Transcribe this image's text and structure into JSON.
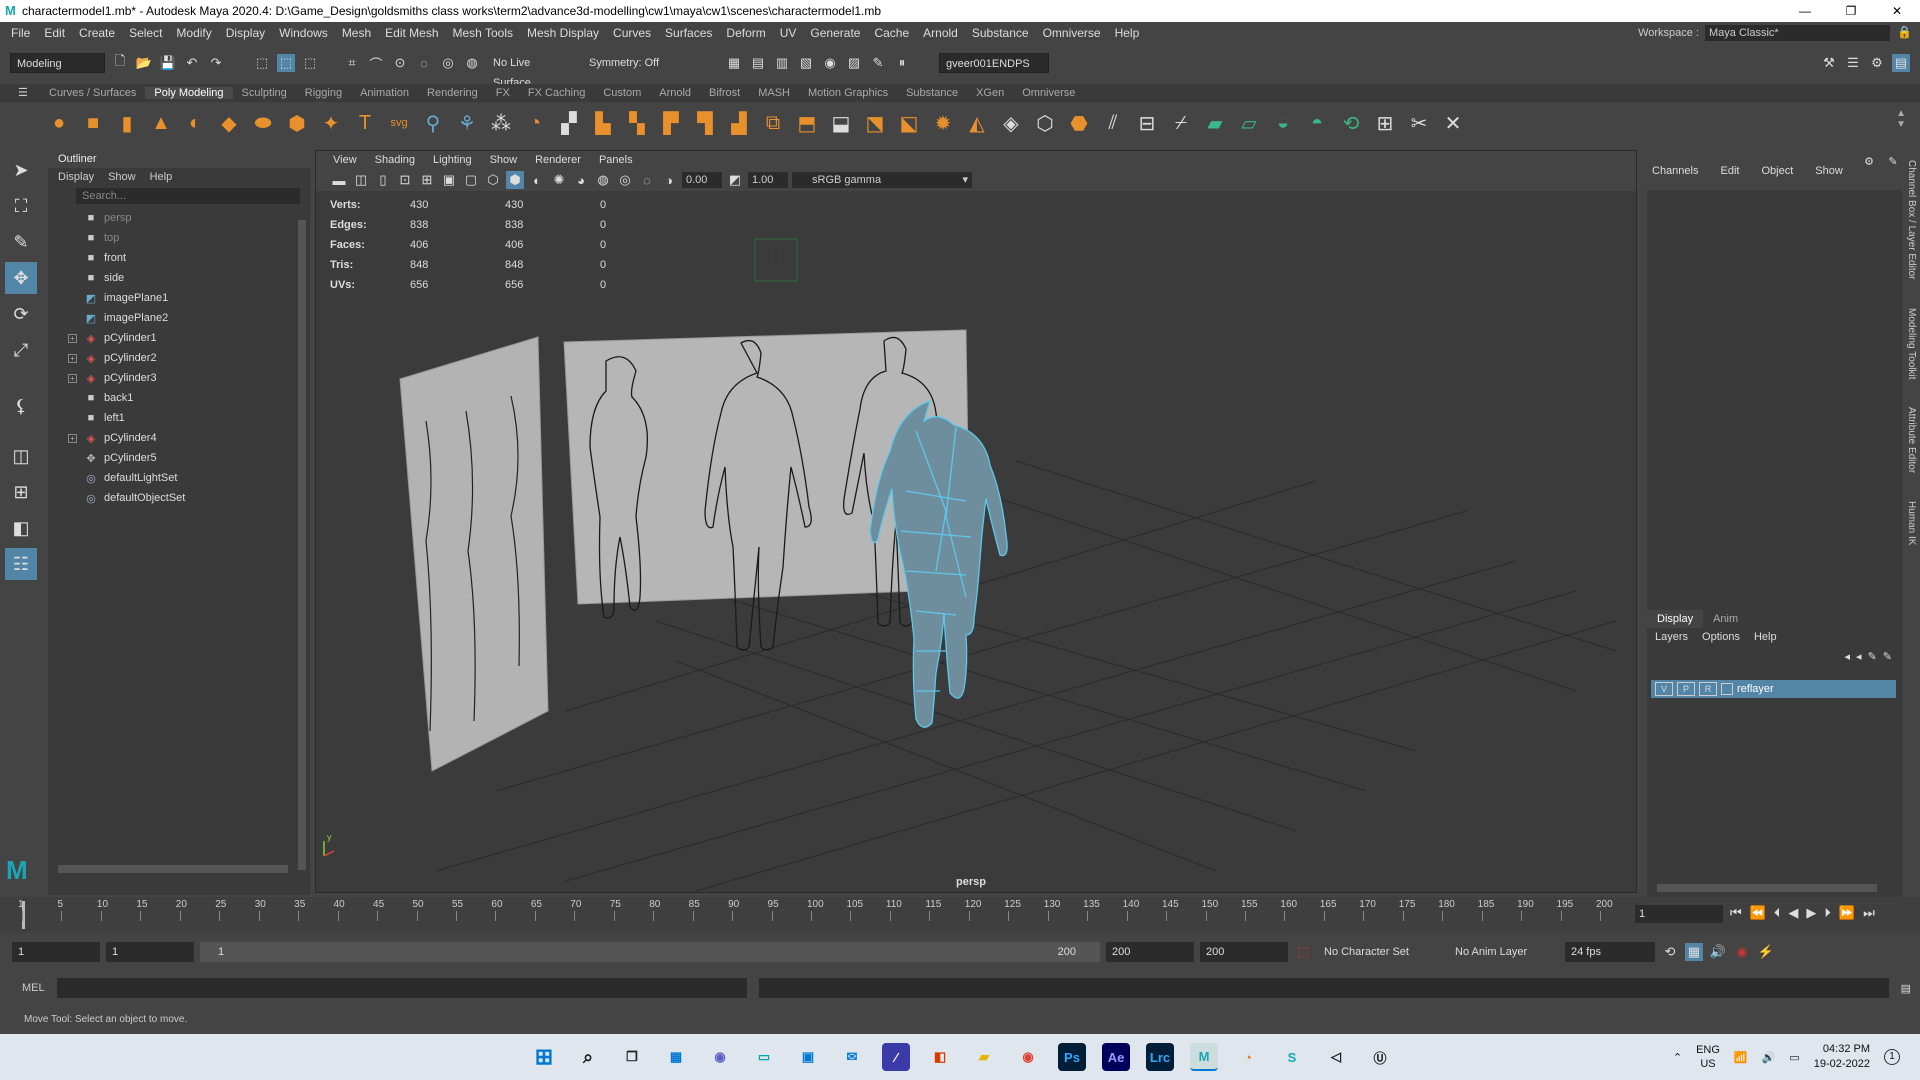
{
  "window": {
    "title": "charactermodel1.mb* - Autodesk Maya 2020.4: D:\\Game_Design\\goldsmiths class works\\term2\\advance3d-modelling\\cw1\\maya\\cw1\\scenes\\charactermodel1.mb",
    "minimize": "—",
    "maximize": "❐",
    "close": "✕"
  },
  "menu": [
    "File",
    "Edit",
    "Create",
    "Select",
    "Modify",
    "Display",
    "Windows",
    "Mesh",
    "Edit Mesh",
    "Mesh Tools",
    "Mesh Display",
    "Curves",
    "Surfaces",
    "Deform",
    "UV",
    "Generate",
    "Cache",
    "Arnold",
    "Substance",
    "Omniverse",
    "Help"
  ],
  "workspace": {
    "label": "Workspace :",
    "value": "Maya Classic*"
  },
  "statusline": {
    "menuset": "Modeling",
    "live_surface": "No Live Surface",
    "symmetry": "Symmetry: Off",
    "user": "gveer001ENDPS"
  },
  "shelf_tabs": [
    "Curves / Surfaces",
    "Poly Modeling",
    "Sculpting",
    "Rigging",
    "Animation",
    "Rendering",
    "FX",
    "FX Caching",
    "Custom",
    "Arnold",
    "Bifrost",
    "MASH",
    "Motion Graphics",
    "Substance",
    "XGen",
    "Omniverse"
  ],
  "shelf_active": "Poly Modeling",
  "outliner": {
    "title": "Outliner",
    "menu": [
      "Display",
      "Show",
      "Help"
    ],
    "search_placeholder": "Search...",
    "items": [
      {
        "label": "persp",
        "icon": "camera-icon",
        "dim": true,
        "expand": false
      },
      {
        "label": "top",
        "icon": "camera-icon",
        "dim": true,
        "expand": false
      },
      {
        "label": "front",
        "icon": "camera-icon",
        "dim": false,
        "expand": false
      },
      {
        "label": "side",
        "icon": "camera-icon",
        "dim": false,
        "expand": false
      },
      {
        "label": "imagePlane1",
        "icon": "image-plane-icon",
        "dim": false,
        "expand": false
      },
      {
        "label": "imagePlane2",
        "icon": "image-plane-icon",
        "dim": false,
        "expand": false
      },
      {
        "label": "pCylinder1",
        "icon": "mesh-icon",
        "dim": false,
        "expand": true
      },
      {
        "label": "pCylinder2",
        "icon": "mesh-icon",
        "dim": false,
        "expand": true
      },
      {
        "label": "pCylinder3",
        "icon": "mesh-icon",
        "dim": false,
        "expand": true
      },
      {
        "label": "back1",
        "icon": "camera-icon",
        "dim": false,
        "expand": false
      },
      {
        "label": "left1",
        "icon": "camera-icon",
        "dim": false,
        "expand": false
      },
      {
        "label": "pCylinder4",
        "icon": "mesh-icon",
        "dim": false,
        "expand": true
      },
      {
        "label": "pCylinder5",
        "icon": "transform-icon",
        "dim": false,
        "expand": false
      },
      {
        "label": "defaultLightSet",
        "icon": "set-icon",
        "dim": false,
        "expand": false
      },
      {
        "label": "defaultObjectSet",
        "icon": "set-icon",
        "dim": false,
        "expand": false
      }
    ]
  },
  "viewport": {
    "menu": [
      "View",
      "Shading",
      "Lighting",
      "Show",
      "Renderer",
      "Panels"
    ],
    "exposure": "0.00",
    "gamma": "1.00",
    "colorspace": "sRGB gamma",
    "camera": "persp",
    "hud": [
      {
        "k": "Verts:",
        "a": "430",
        "b": "430",
        "c": "0"
      },
      {
        "k": "Edges:",
        "a": "838",
        "b": "838",
        "c": "0"
      },
      {
        "k": "Faces:",
        "a": "406",
        "b": "406",
        "c": "0"
      },
      {
        "k": "Tris:",
        "a": "848",
        "b": "848",
        "c": "0"
      },
      {
        "k": "UVs:",
        "a": "656",
        "b": "656",
        "c": "0"
      }
    ],
    "axis_y": "y",
    "mesh_color": "#5ec8ea"
  },
  "channelbox": {
    "menu": [
      "Channels",
      "Edit",
      "Object",
      "Show"
    ]
  },
  "layers": {
    "tabs": [
      "Display",
      "Anim"
    ],
    "menu": [
      "Layers",
      "Options",
      "Help"
    ],
    "v": "V",
    "p": "P",
    "r": "R",
    "name": "reflayer"
  },
  "sidetabs": [
    "Channel Box / Layer Editor",
    "Modeling Toolkit",
    "Attribute Editor",
    "Human IK"
  ],
  "timeline": {
    "ticks": [
      "1",
      "5",
      "10",
      "15",
      "20",
      "25",
      "30",
      "35",
      "40",
      "45",
      "50",
      "55",
      "60",
      "65",
      "70",
      "75",
      "80",
      "85",
      "90",
      "95",
      "100",
      "105",
      "110",
      "115",
      "120",
      "125",
      "130",
      "135",
      "140",
      "145",
      "150",
      "155",
      "160",
      "165",
      "170",
      "175",
      "180",
      "185",
      "190",
      "195",
      "200"
    ],
    "current": "1"
  },
  "range": {
    "start": "1",
    "inner_start": "1",
    "slider_start": "1",
    "slider_end": "200",
    "end": "200",
    "anim_end": "200",
    "char_set": "No Character Set",
    "anim_layer": "No Anim Layer",
    "fps": "24 fps"
  },
  "cmd": {
    "label": "MEL"
  },
  "help_line": "Move Tool: Select an object to move.",
  "taskbar": {
    "lang": "ENG",
    "region": "US",
    "time": "04:32 PM",
    "date": "19-02-2022",
    "badge": "1"
  }
}
